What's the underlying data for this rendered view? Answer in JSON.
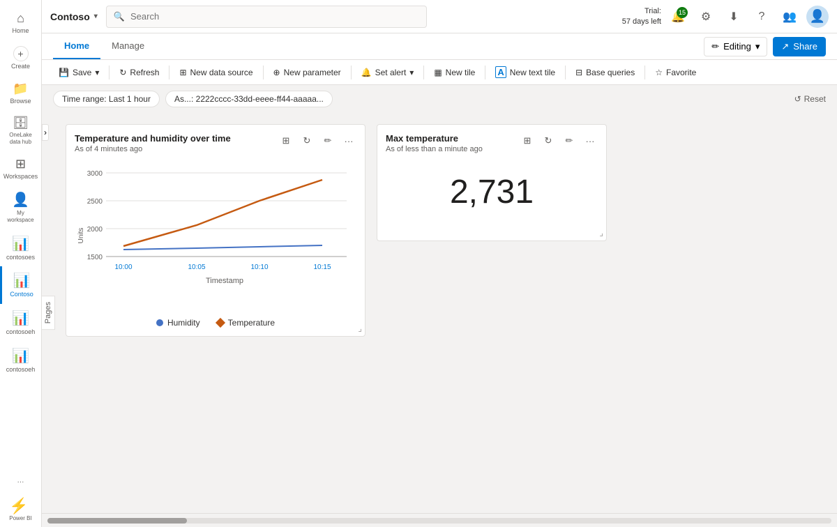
{
  "brand": {
    "name": "Contoso",
    "chevron": "▾"
  },
  "search": {
    "placeholder": "Search"
  },
  "trial": {
    "label": "Trial:",
    "days": "57 days left"
  },
  "notifications": {
    "count": "15"
  },
  "tabs": [
    {
      "id": "home",
      "label": "Home",
      "active": true
    },
    {
      "id": "manage",
      "label": "Manage",
      "active": false
    }
  ],
  "editing": {
    "label": "Editing"
  },
  "share": {
    "label": "Share"
  },
  "toolbar": {
    "buttons": [
      {
        "id": "save",
        "icon": "💾",
        "label": "Save",
        "hasDropdown": true
      },
      {
        "id": "refresh",
        "icon": "↻",
        "label": "Refresh",
        "hasDropdown": false
      },
      {
        "id": "new-datasource",
        "icon": "⊞",
        "label": "New data source",
        "hasDropdown": false
      },
      {
        "id": "new-parameter",
        "icon": "⊕",
        "label": "New parameter",
        "hasDropdown": false
      },
      {
        "id": "set-alert",
        "icon": "🔔",
        "label": "Set alert",
        "hasDropdown": true
      },
      {
        "id": "new-tile",
        "icon": "▦",
        "label": "New tile",
        "hasDropdown": false
      },
      {
        "id": "new-text",
        "icon": "A",
        "label": "New text tile",
        "hasDropdown": false
      },
      {
        "id": "base-queries",
        "icon": "⊟",
        "label": "Base queries",
        "hasDropdown": false
      },
      {
        "id": "favorite",
        "icon": "☆",
        "label": "Favorite",
        "hasDropdown": false
      }
    ]
  },
  "filters": {
    "timeRange": "Time range: Last 1 hour",
    "asFilter": "As...: 2222cccc-33dd-eeee-ff44-aaaaa..."
  },
  "resetBtn": "Reset",
  "charts": [
    {
      "id": "chart1",
      "title": "Temperature and humidity over time",
      "subtitle": "As of 4 minutes ago",
      "type": "line",
      "yLabel": "Units",
      "xLabel": "Timestamp",
      "xTicks": [
        "10:00",
        "10:05",
        "10:10",
        "10:15"
      ],
      "yTicks": [
        "1500",
        "2000",
        "2500",
        "3000"
      ],
      "legend": [
        {
          "label": "Humidity",
          "color": "#4472c4",
          "shape": "circle"
        },
        {
          "label": "Temperature",
          "color": "#c55a11",
          "shape": "diamond"
        }
      ]
    }
  ],
  "metrics": [
    {
      "id": "metric1",
      "title": "Max temperature",
      "subtitle": "As of less than a minute ago",
      "value": "2,731"
    }
  ],
  "sidebar": {
    "items": [
      {
        "id": "home",
        "icon": "⌂",
        "label": "Home"
      },
      {
        "id": "create",
        "icon": "+",
        "label": "Create"
      },
      {
        "id": "browse",
        "icon": "📁",
        "label": "Browse"
      },
      {
        "id": "onelake",
        "icon": "🗄",
        "label": "OneLake data hub"
      },
      {
        "id": "workspaces",
        "icon": "⊞",
        "label": "Workspaces"
      },
      {
        "id": "my-workspace",
        "icon": "👤",
        "label": "My workspace"
      },
      {
        "id": "contoso-es",
        "icon": "📊",
        "label": "contosoes"
      },
      {
        "id": "contoso-active",
        "icon": "📊",
        "label": "Contoso"
      },
      {
        "id": "contoso-eh1",
        "icon": "📊",
        "label": "contosoeh"
      },
      {
        "id": "contoso-eh2",
        "icon": "📊",
        "label": "contosoeh"
      }
    ],
    "moreLabel": "...",
    "logo": "⚡"
  },
  "pages": {
    "label": "Pages"
  },
  "colors": {
    "primary": "#0078d4",
    "accent": "#107c10",
    "warning": "#f6b844"
  }
}
